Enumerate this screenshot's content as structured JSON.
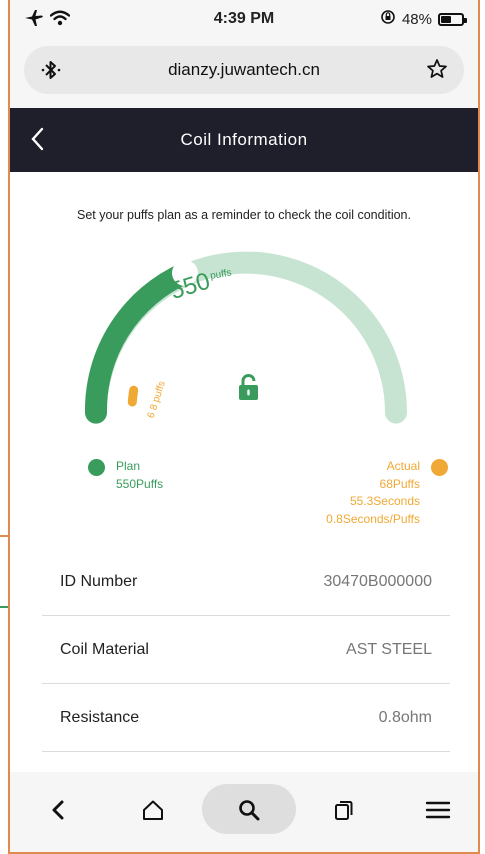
{
  "status_bar": {
    "time": "4:39 PM",
    "battery_text": "48%",
    "battery_level": 0.48
  },
  "browser": {
    "url": "dianzy.juwantech.cn"
  },
  "header": {
    "title": "Coil Information"
  },
  "intro_text": "Set your puffs plan as a reminder to check the coil condition.",
  "gauge": {
    "plan_value": "550",
    "plan_unit": "puffs",
    "actual_value": "68",
    "actual_unit": "puffs",
    "lock_state": "unlocked",
    "track_color": "#c7e4d2",
    "plan_color": "#3a9c5c",
    "actual_color": "#f0a934"
  },
  "legend": {
    "plan_label": "Plan",
    "plan_value": "550Puffs",
    "actual_label": "Actual",
    "actual_puffs": "68Puffs",
    "actual_seconds": "55.3Seconds",
    "actual_rate": "0.8Seconds/Puffs"
  },
  "info_rows": [
    {
      "label": "ID Number",
      "value": "30470B000000"
    },
    {
      "label": "Coil Material",
      "value": "AST STEEL"
    },
    {
      "label": "Resistance",
      "value": "0.8ohm"
    }
  ],
  "icons": {
    "status_left": [
      "airplane-icon",
      "wifi-icon"
    ],
    "status_right": [
      "orientation-lock-icon",
      "battery-icon"
    ],
    "url_left": "bluetooth-icon",
    "url_right": "star-icon",
    "header_left": "back-chevron-icon",
    "bottom": [
      "back-icon",
      "home-icon",
      "search-icon",
      "tabs-icon",
      "menu-icon"
    ]
  }
}
